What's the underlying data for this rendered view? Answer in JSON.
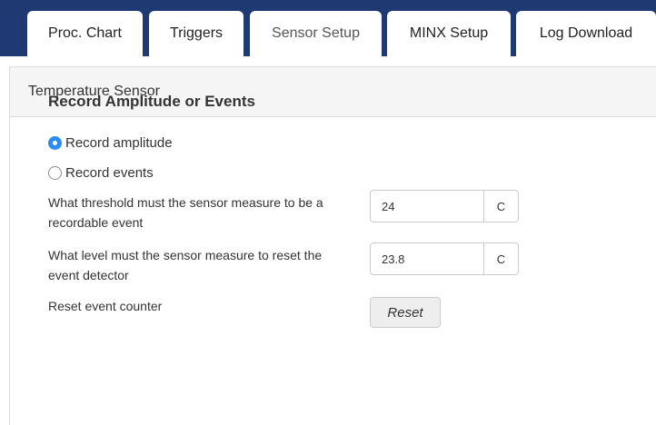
{
  "tabs": [
    {
      "label": "Proc. Chart",
      "active": false
    },
    {
      "label": "Triggers",
      "active": false
    },
    {
      "label": "Sensor Setup",
      "active": true
    },
    {
      "label": "MINX Setup",
      "active": false
    },
    {
      "label": "Log Download",
      "active": false
    }
  ],
  "panel": {
    "heading": "Temperature Sensor",
    "section_title": "Record Amplitude or Events",
    "radio_options": [
      {
        "label": "Record amplitude",
        "checked": true
      },
      {
        "label": "Record events",
        "checked": false
      }
    ],
    "fields": [
      {
        "label": "What threshold must the sensor measure to be a recordable event",
        "value": "24",
        "unit": "C"
      },
      {
        "label": "What level must the sensor measure to reset the event detector",
        "value": "23.8",
        "unit": "C"
      }
    ],
    "reset_label": "Reset event counter",
    "reset_button": "Reset"
  },
  "colors": {
    "tabbar_bg": "#1f3a72",
    "radio_checked": "#2b8cf3",
    "panel_heading_bg": "#f5f5f5"
  }
}
